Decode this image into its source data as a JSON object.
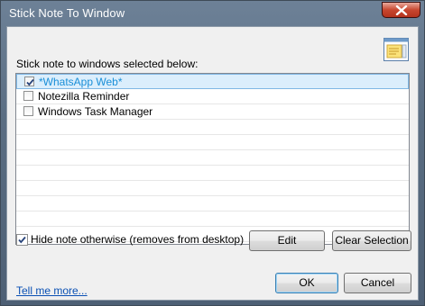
{
  "window": {
    "title": "Stick Note To Window"
  },
  "label": "Stick note to windows selected below:",
  "windows_list": [
    {
      "label": "*WhatsApp Web*",
      "checked": true,
      "selected": true
    },
    {
      "label": "Notezilla Reminder",
      "checked": false,
      "selected": false
    },
    {
      "label": "Windows Task Manager",
      "checked": false,
      "selected": false
    }
  ],
  "hide_option": {
    "label": "Hide note otherwise (removes from desktop)",
    "checked": true
  },
  "buttons": {
    "edit": "Edit",
    "clear": "Clear Selection",
    "ok": "OK",
    "cancel": "Cancel"
  },
  "link": "Tell me more...",
  "colors": {
    "selected_text": "#1a8fd8",
    "link": "#0a50b4",
    "close": "#c8472f"
  },
  "icons": {
    "close": "close-icon",
    "note": "sticky-note-window-icon"
  }
}
